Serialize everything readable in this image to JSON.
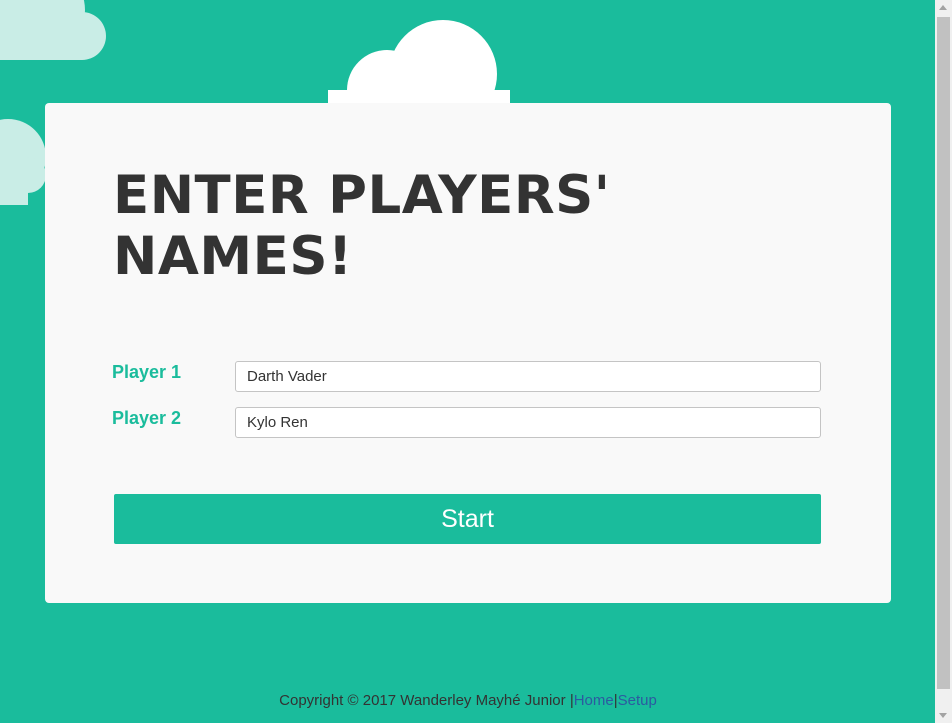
{
  "setup": {
    "title": "ENTER PLAYERS' NAMES!",
    "players": [
      {
        "label": "Player 1",
        "value": "Darth Vader"
      },
      {
        "label": "Player 2",
        "value": "Kylo Ren"
      }
    ],
    "start_label": "Start"
  },
  "footer": {
    "copyright": "Copyright © 2017 Wanderley Mayhé Junior",
    "separator": "|",
    "home_label": "Home",
    "setup_label": "Setup"
  },
  "colors": {
    "background": "#1abc9c",
    "card": "#f9f9f9",
    "accent": "#1abc9c",
    "heading": "#333333",
    "link": "#2c5aa0"
  }
}
